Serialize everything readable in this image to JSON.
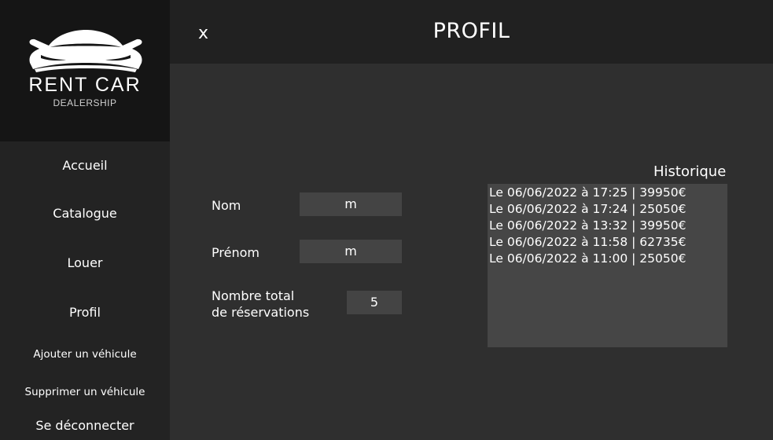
{
  "brand": {
    "title": "RENT CAR",
    "subtitle": "DEALERSHIP"
  },
  "sidebar": {
    "items": [
      {
        "label": "Accueil"
      },
      {
        "label": "Catalogue"
      },
      {
        "label": "Louer"
      },
      {
        "label": "Profil"
      },
      {
        "label": "Ajouter un véhicule"
      },
      {
        "label": "Supprimer un véhicule"
      },
      {
        "label": "Se déconnecter"
      }
    ]
  },
  "header": {
    "close_label": "x",
    "title": "PROFIL"
  },
  "profile": {
    "nom_label": "Nom",
    "nom_value": "m",
    "prenom_label": "Prénom",
    "prenom_value": "m",
    "total_label_line1": "Nombre total",
    "total_label_line2": "de réservations",
    "total_value": "5"
  },
  "history": {
    "title": "Historique",
    "items": [
      "Le 06/06/2022 à 17:25 | 39950€",
      "Le 06/06/2022 à 17:24 | 25050€",
      "Le 06/06/2022 à 13:32 | 39950€",
      "Le 06/06/2022 à 11:58 | 62735€",
      "Le 06/06/2022 à 11:00 | 25050€"
    ]
  },
  "colors": {
    "sidebar_bg": "#232323",
    "logo_bg": "#151515",
    "topbar_bg": "#212121",
    "main_bg": "#2f2f2f",
    "field_bg": "#444444",
    "history_bg": "#464646"
  }
}
